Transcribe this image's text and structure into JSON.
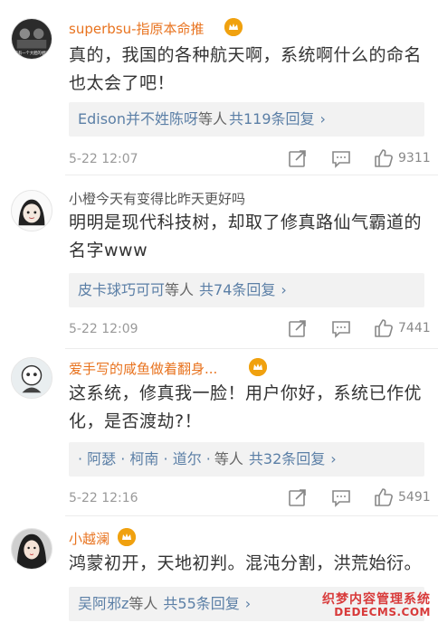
{
  "comments": [
    {
      "username": "superbsu-指原本命推",
      "username_color": "#e8731f",
      "has_badge": true,
      "avatar_caption": "我有一个大胆的想法",
      "lines": [
        "真的，我国的各种航天啊，系统啊什么的命名",
        "也太会了吧！"
      ],
      "reply_names": "Edison并不姓陈呀",
      "reply_mid": "等人",
      "reply_count": "共119条回复",
      "time": "5-22 12:07",
      "likes": "9311"
    },
    {
      "username": "小橙今天有变得比昨天更好吗",
      "username_color": "#555555",
      "has_badge": false,
      "lines": [
        "明明是现代科技树，却取了修真路仙气霸道的",
        "名字www"
      ],
      "reply_names": "皮卡球巧可可",
      "reply_mid": "等人",
      "reply_count": "共74条回复",
      "time": "5-22 12:09",
      "likes": "7441"
    },
    {
      "username": "爱手写的咸鱼做着翻身...",
      "username_color": "#e8731f",
      "has_badge": true,
      "lines": [
        "这系统，修真我一脸！用户你好，系统已作优",
        "化，是否渡劫?！"
      ],
      "reply_names": "· 阿瑟 · 柯南 · 道尔 ·",
      "reply_mid": "等人",
      "reply_count": "共32条回复",
      "time": "5-22 12:16",
      "likes": "5491"
    },
    {
      "username": "小越澜",
      "username_color": "#e8731f",
      "has_badge": true,
      "lines": [
        "鸿蒙初开，天地初判。混沌分割，洪荒始衍。"
      ],
      "reply_names": "吴阿邪z",
      "reply_mid": "等人",
      "reply_count": "共55条回复",
      "time": "",
      "likes": ""
    }
  ],
  "icons": {
    "badge": "vip-crown-icon",
    "share": "share-icon",
    "comment": "comment-icon",
    "like": "thumbs-up-icon",
    "chevron": "chevron-right-icon"
  },
  "watermark": {
    "line1": "织梦内容管理系统",
    "line2": "DEDECMS.COM"
  }
}
